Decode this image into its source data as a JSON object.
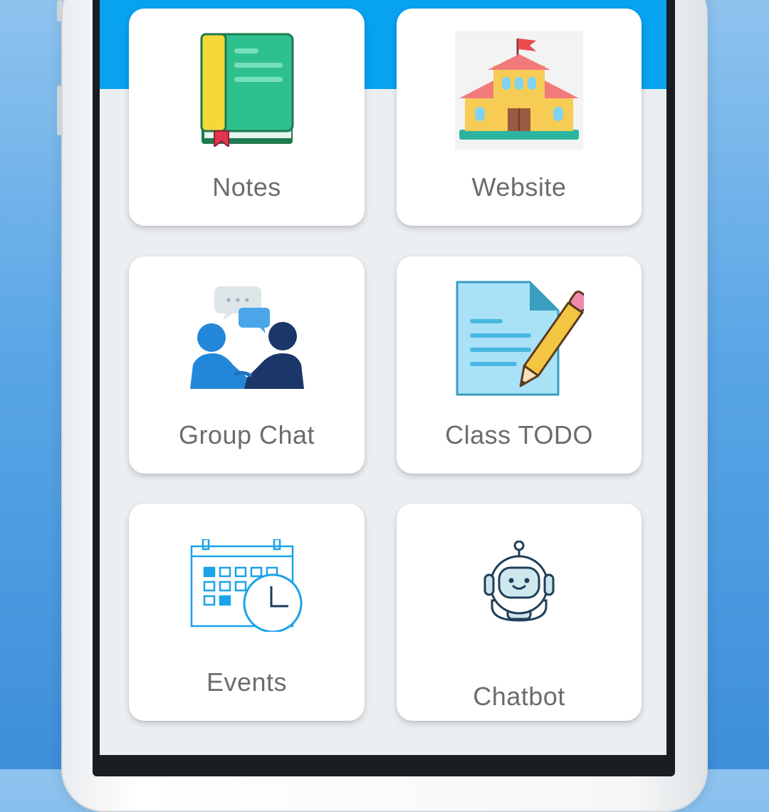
{
  "colors": {
    "header": "#07a2f0",
    "screen_bg": "#eceff2",
    "card_bg": "#ffffff",
    "label": "#6c6c6c"
  },
  "tiles": [
    {
      "label": "Notes",
      "icon": "book-icon"
    },
    {
      "label": "Website",
      "icon": "school-icon"
    },
    {
      "label": "Group Chat",
      "icon": "group-chat-icon"
    },
    {
      "label": "Class TODO",
      "icon": "todo-document-icon"
    },
    {
      "label": "Events",
      "icon": "calendar-clock-icon"
    },
    {
      "label": "Chatbot",
      "icon": "robot-icon"
    }
  ]
}
